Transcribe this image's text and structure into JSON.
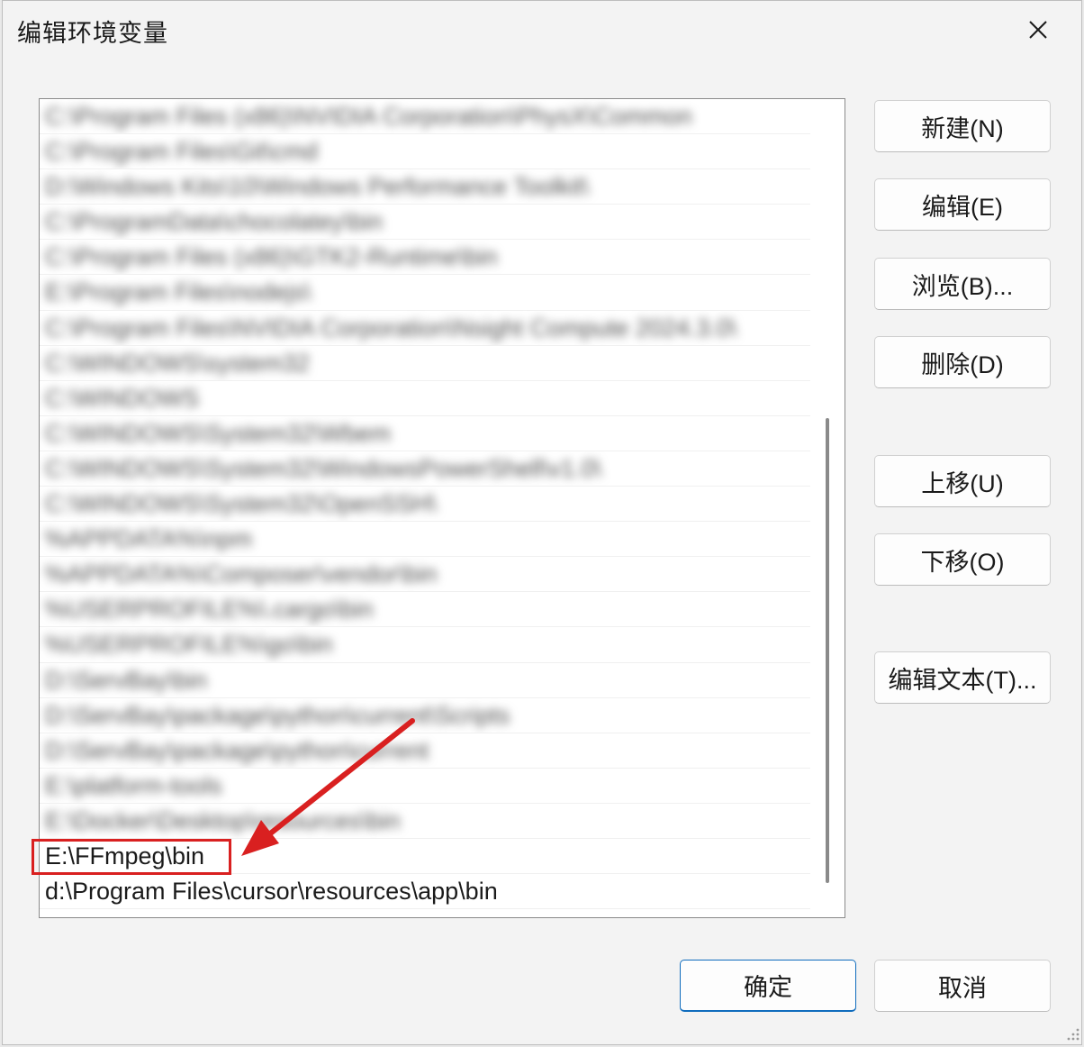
{
  "dialog": {
    "title": "编辑环境变量",
    "close_icon": "close-icon"
  },
  "path_list": {
    "entries": [
      {
        "text": "C:\\Program Files (x86)\\NVIDIA Corporation\\PhysX\\Common",
        "blurred": true
      },
      {
        "text": "C:\\Program Files\\Git\\cmd",
        "blurred": true
      },
      {
        "text": "D:\\Windows Kits\\10\\Windows Performance Toolkit\\",
        "blurred": true
      },
      {
        "text": "C:\\ProgramData\\chocolatey\\bin",
        "blurred": true
      },
      {
        "text": "C:\\Program Files (x86)\\GTK2-Runtime\\bin",
        "blurred": true
      },
      {
        "text": "E:\\Program Files\\nodejs\\",
        "blurred": true
      },
      {
        "text": "C:\\Program Files\\NVIDIA Corporation\\Nsight Compute 2024.3.0\\",
        "blurred": true
      },
      {
        "text": "C:\\WINDOWS\\system32",
        "blurred": true
      },
      {
        "text": "C:\\WINDOWS",
        "blurred": true
      },
      {
        "text": "C:\\WINDOWS\\System32\\Wbem",
        "blurred": true
      },
      {
        "text": "C:\\WINDOWS\\System32\\WindowsPowerShell\\v1.0\\",
        "blurred": true
      },
      {
        "text": "C:\\WINDOWS\\System32\\OpenSSH\\",
        "blurred": true
      },
      {
        "text": "%APPDATA%\\npm",
        "blurred": true
      },
      {
        "text": "%APPDATA%\\Composer\\vendor\\bin",
        "blurred": true
      },
      {
        "text": "%USERPROFILE%\\.cargo\\bin",
        "blurred": true
      },
      {
        "text": "%USERPROFILE%\\go\\bin",
        "blurred": true
      },
      {
        "text": "D:\\ServBay\\bin",
        "blurred": true
      },
      {
        "text": "D:\\ServBay\\package\\python\\current\\Scripts",
        "blurred": true
      },
      {
        "text": "D:\\ServBay\\package\\python\\current",
        "blurred": true
      },
      {
        "text": "E:\\platform-tools",
        "blurred": true
      },
      {
        "text": "E:\\Docker\\Desktop\\resources\\bin",
        "blurred": true
      },
      {
        "text": "E:\\FFmpeg\\bin",
        "blurred": false
      },
      {
        "text": "d:\\Program Files\\cursor\\resources\\app\\bin",
        "blurred": false
      }
    ]
  },
  "buttons": {
    "new": "新建(N)",
    "edit": "编辑(E)",
    "browse": "浏览(B)...",
    "delete": "删除(D)",
    "move_up": "上移(U)",
    "move_down": "下移(O)",
    "edit_text": "编辑文本(T)...",
    "ok": "确定",
    "cancel": "取消"
  },
  "annotation": {
    "color": "#d92020"
  }
}
